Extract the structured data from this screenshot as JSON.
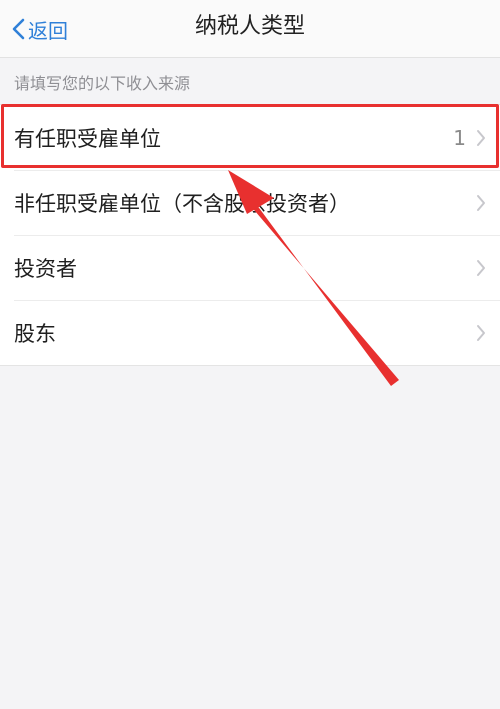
{
  "nav": {
    "back_label": "返回",
    "title": "纳税人类型"
  },
  "section_header": "请填写您的以下收入来源",
  "rows": [
    {
      "label": "有任职受雇单位",
      "count": "1"
    },
    {
      "label": "非任职受雇单位（不含股东投资者）",
      "count": ""
    },
    {
      "label": "投资者",
      "count": ""
    },
    {
      "label": "股东",
      "count": ""
    }
  ],
  "colors": {
    "accent": "#2f80d8",
    "highlight": "#e8302f"
  }
}
